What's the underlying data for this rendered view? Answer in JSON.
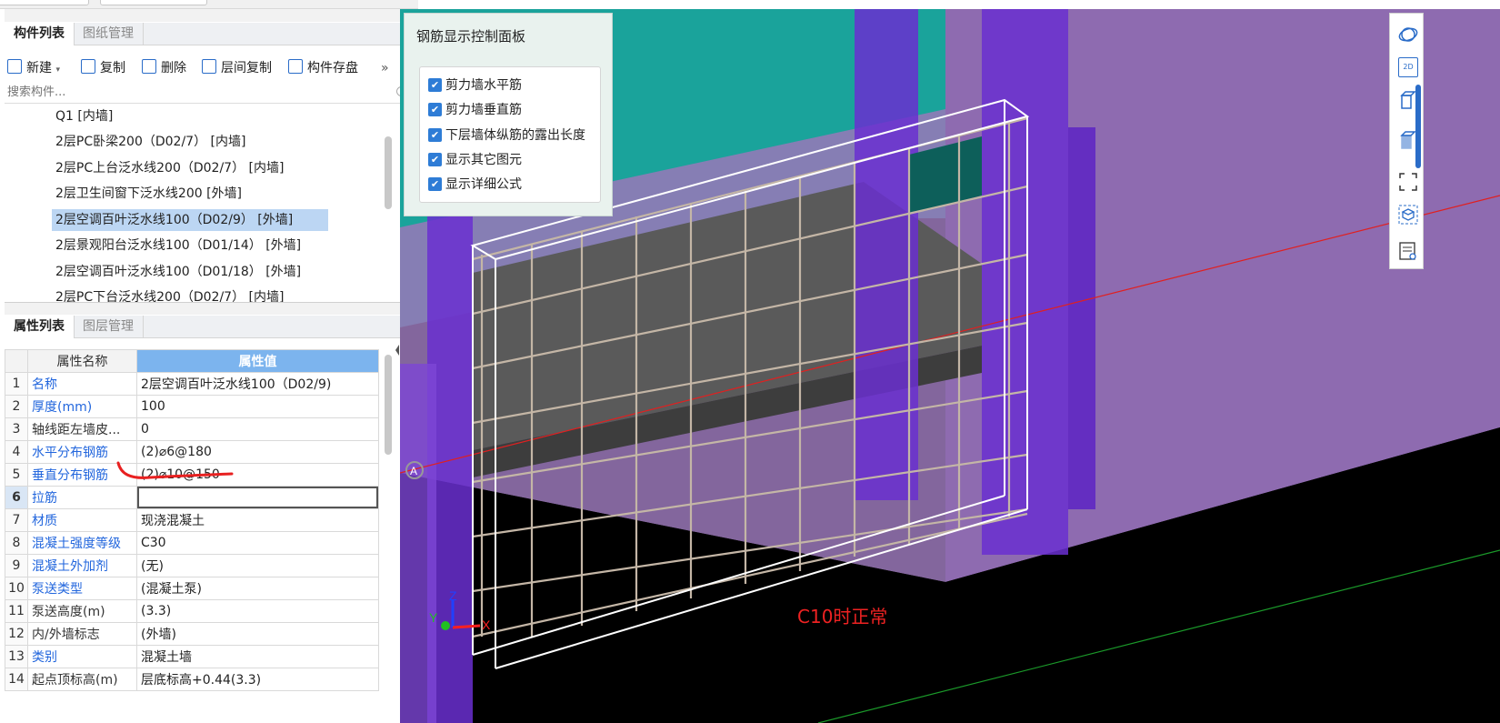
{
  "top_panel": {
    "tabs": [
      "构件列表",
      "图纸管理"
    ],
    "toolbar": {
      "new": "新建",
      "copy": "复制",
      "delete": "删除",
      "floor_copy": "层间复制",
      "save": "构件存盘",
      "more": "»"
    },
    "search_placeholder": "搜索构件...",
    "items": [
      "Q1 [内墙]",
      "2层PC卧梁200（D02/7） [内墙]",
      "2层PC上台泛水线200（D02/7） [内墙]",
      "2层卫生间窗下泛水线200 [外墙]",
      "2层空调百叶泛水线100（D02/9） [外墙]",
      "2层景观阳台泛水线100（D01/14） [外墙]",
      "2层空调百叶泛水线100（D01/18） [外墙]",
      "2层PC下台泛水线200（D02/7） [内墙]"
    ],
    "selected_index": 4
  },
  "bottom_panel": {
    "tabs": [
      "属性列表",
      "图层管理"
    ],
    "header": {
      "name_col": "属性名称",
      "value_col": "属性值"
    },
    "rows": [
      {
        "no": "1",
        "name": "名称",
        "value": "2层空调百叶泛水线100（D02/9)",
        "blue": true
      },
      {
        "no": "2",
        "name": "厚度(mm)",
        "value": "100",
        "blue": true
      },
      {
        "no": "3",
        "name": "轴线距左墙皮...",
        "value": "0",
        "blue": false
      },
      {
        "no": "4",
        "name": "水平分布钢筋",
        "value": "(2)⌀6@180",
        "blue": true
      },
      {
        "no": "5",
        "name": "垂直分布钢筋",
        "value": "(2)⌀10@150",
        "blue": true
      },
      {
        "no": "6",
        "name": "拉筋",
        "value": "",
        "blue": true,
        "active": true
      },
      {
        "no": "7",
        "name": "材质",
        "value": "现浇混凝土",
        "blue": true
      },
      {
        "no": "8",
        "name": "混凝土强度等级",
        "value": "C30",
        "blue": true
      },
      {
        "no": "9",
        "name": "混凝土外加剂",
        "value": "(无)",
        "blue": true
      },
      {
        "no": "10",
        "name": "泵送类型",
        "value": "(混凝土泵)",
        "blue": true
      },
      {
        "no": "11",
        "name": "泵送高度(m)",
        "value": "(3.3)",
        "blue": false
      },
      {
        "no": "12",
        "name": "内/外墙标志",
        "value": "(外墙)",
        "blue": false
      },
      {
        "no": "13",
        "name": "类别",
        "value": "混凝土墙",
        "blue": true
      },
      {
        "no": "14",
        "name": "起点顶标高(m)",
        "value": "层底标高+0.44(3.3)",
        "blue": false
      }
    ]
  },
  "control_panel": {
    "title": "钢筋显示控制面板",
    "options": [
      {
        "label": "剪力墙水平筋",
        "checked": true
      },
      {
        "label": "剪力墙垂直筋",
        "checked": true
      },
      {
        "label": "下层墙体纵筋的露出长度",
        "checked": true
      },
      {
        "label": "显示其它图元",
        "checked": true
      },
      {
        "label": "显示详细公式",
        "checked": true
      }
    ]
  },
  "viewport": {
    "annotation": "C10时正常",
    "axes": {
      "x": "X",
      "y": "Y",
      "z": "Z"
    },
    "marker": "A"
  },
  "right_toolbar": {
    "icons": [
      "orbit-icon",
      "2d-view-icon",
      "cube-view-icon",
      "cube-view-alt-icon",
      "fullscreen-icon",
      "box-select-icon",
      "properties-icon"
    ],
    "view2d_label": "2D"
  },
  "colors": {
    "accent": "#2e7cd6",
    "selected_row": "#bcd6f3",
    "header_blue": "#7cb4ee",
    "annotation_red": "#ee2222",
    "teal": "#1aa39b",
    "purple": "#8e6bb0"
  }
}
